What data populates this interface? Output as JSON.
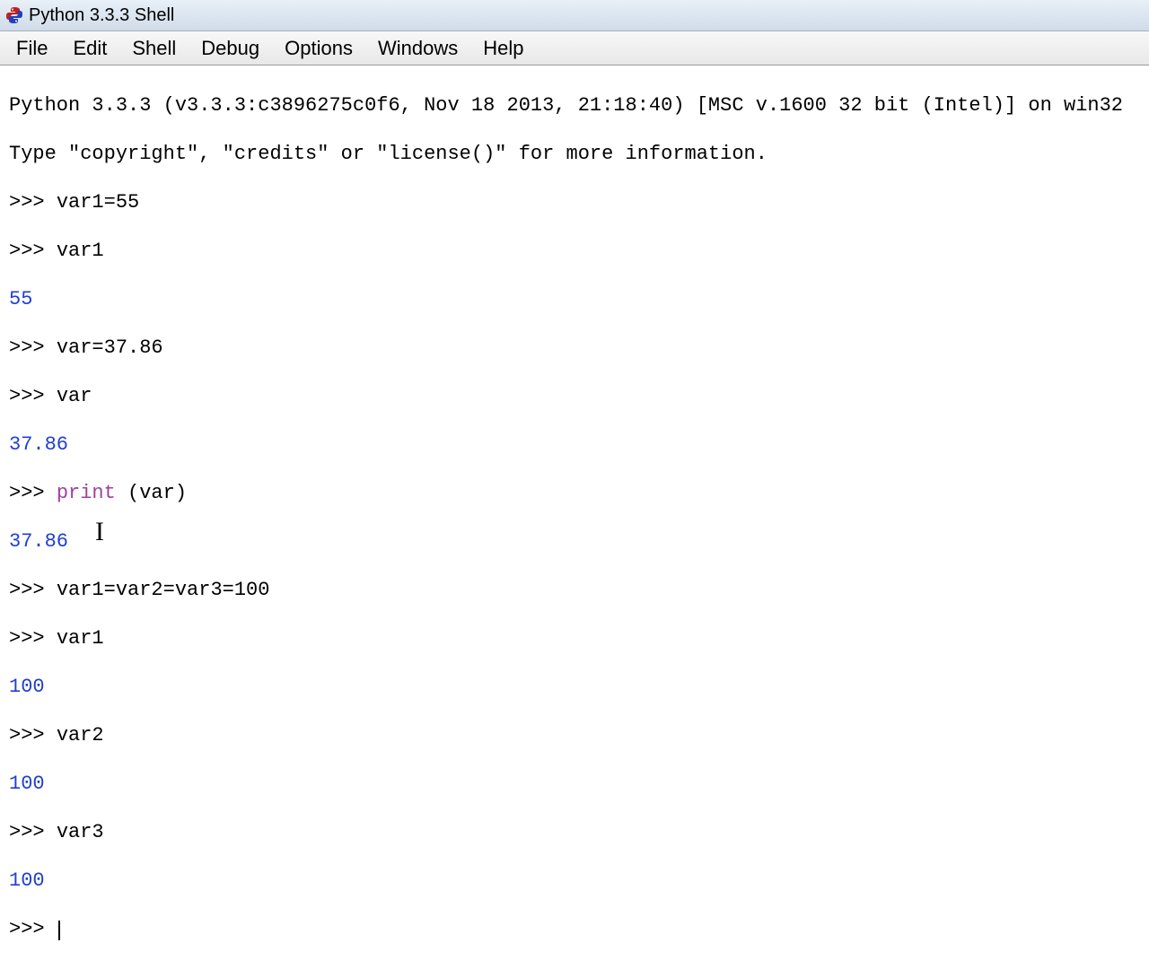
{
  "title": "Python 3.3.3 Shell",
  "menu": {
    "file": "File",
    "edit": "Edit",
    "shell": "Shell",
    "debug": "Debug",
    "options": "Options",
    "windows": "Windows",
    "help": "Help"
  },
  "shell": {
    "banner1": "Python 3.3.3 (v3.3.3:c3896275c0f6, Nov 18 2013, 21:18:40) [MSC v.1600 32 bit (Intel)] on win32",
    "banner2": "Type \"copyright\", \"credits\" or \"license()\" for more information.",
    "prompt": ">>> ",
    "lines": {
      "l1_in": "var1=55",
      "l2_in": "var1",
      "l2_out": "55",
      "l3_in": "var=37.86",
      "l4_in": "var",
      "l4_out": "37.86",
      "l5_print": "print",
      "l5_rest": " (var)",
      "l5_out": "37.86",
      "l6_in": "var1=var2=var3=100",
      "l7_in": "var1",
      "l7_out": "100",
      "l8_in": "var2",
      "l8_out": "100",
      "l9_in": "var3",
      "l9_out": "100"
    }
  }
}
